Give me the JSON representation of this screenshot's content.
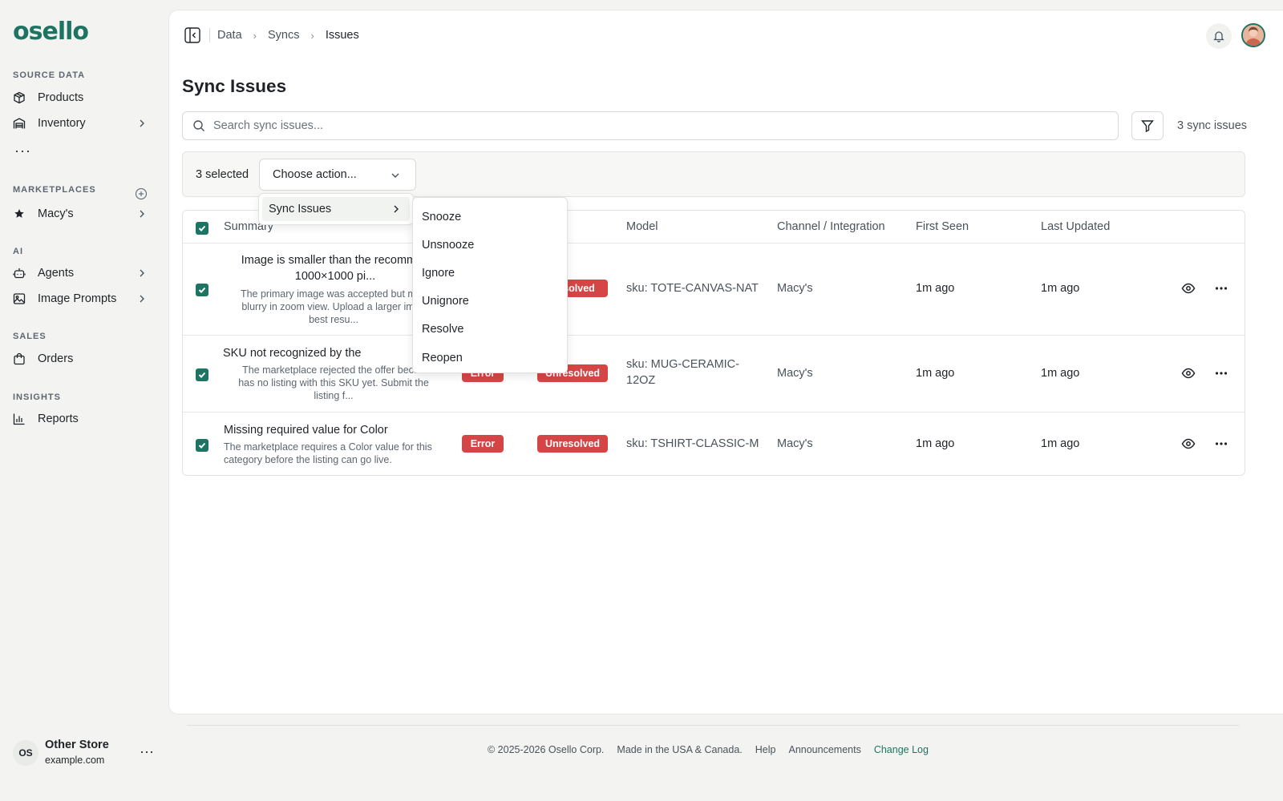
{
  "brand": {
    "logo_text": "osello",
    "accent": "#1d7462"
  },
  "sidebar": {
    "sections": {
      "source_data": "SOURCE DATA",
      "marketplaces": "MARKETPLACES",
      "ai": "AI",
      "sales": "SALES",
      "insights": "INSIGHTS"
    },
    "items": {
      "products": "Products",
      "inventory": "Inventory",
      "macys": "Macy's",
      "agents": "Agents",
      "image_prompts": "Image Prompts",
      "orders": "Orders",
      "reports": "Reports"
    },
    "more": "···",
    "store": {
      "initials": "OS",
      "name": "Other Store",
      "domain": "example.com",
      "more": "···"
    }
  },
  "header": {
    "breadcrumb": [
      "Data",
      "Syncs",
      "Issues"
    ]
  },
  "page": {
    "title": "Sync Issues",
    "search_placeholder": "Search sync issues...",
    "count_label": "3 sync issues",
    "selected_label": "3 selected",
    "action_placeholder": "Choose action..."
  },
  "table": {
    "columns": {
      "summary": "Summary",
      "model": "Model",
      "channel": "Channel / Integration",
      "first_seen": "First Seen",
      "last_updated": "Last Updated"
    },
    "rows": [
      {
        "title_l1": "Image is smaller than the recommen",
        "title_l2": "1000×1000 pi...",
        "desc_l1": "The primary image was accepted but may",
        "desc_l2": "blurry in zoom view. Upload a larger imag",
        "desc_l3": "best resu...",
        "status": "solved",
        "model": "sku: TOTE-CANVAS-NAT",
        "channel": "Macy's",
        "first_seen": "1m ago",
        "last_updated": "1m ago"
      },
      {
        "title_l1": "SKU not recognized by the marketpla",
        "desc_l1": "The marketplace rejected the offer becau",
        "desc_l2": "has no listing with this SKU yet. Submit the",
        "desc_l3": "listing f...",
        "severity": "Error",
        "status": "Unresolved",
        "model_l1": "sku: MUG-CERAMIC-",
        "model_l2": "12OZ",
        "channel": "Macy's",
        "first_seen": "1m ago",
        "last_updated": "1m ago"
      },
      {
        "title_l1": "Missing required value for Color",
        "desc_l1": "The marketplace requires a Color value for this",
        "desc_l2": "category before the listing can go live.",
        "severity": "Error",
        "status": "Unresolved",
        "model": "sku: TSHIRT-CLASSIC-M",
        "channel": "Macy's",
        "first_seen": "1m ago",
        "last_updated": "1m ago"
      }
    ]
  },
  "menu": {
    "parent": "Sync Issues",
    "items": [
      "Snooze",
      "Unsnooze",
      "Ignore",
      "Unignore",
      "Resolve",
      "Reopen"
    ]
  },
  "footer": {
    "copyright": "© 2025-2026 Osello Corp.",
    "made_in": "Made in the USA & Canada.",
    "help": "Help",
    "announcements": "Announcements",
    "changelog": "Change Log"
  },
  "colors": {
    "error": "#d64545",
    "text": "#1f2328",
    "muted": "#4a525b"
  }
}
